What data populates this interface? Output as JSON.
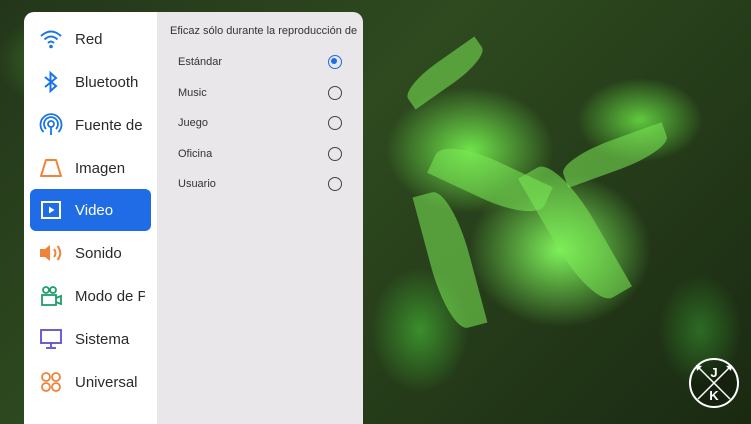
{
  "menu": {
    "items": [
      {
        "label": "Red",
        "icon": "wifi-icon",
        "active": false
      },
      {
        "label": "Bluetooth",
        "icon": "bluetooth-icon",
        "active": false
      },
      {
        "label": "Fuente de S",
        "icon": "source-icon",
        "active": false
      },
      {
        "label": "Imagen",
        "icon": "image-icon",
        "active": false
      },
      {
        "label": "Video",
        "icon": "video-icon",
        "active": true
      },
      {
        "label": "Sonido",
        "icon": "sound-icon",
        "active": false
      },
      {
        "label": "Modo de P",
        "icon": "projector-icon",
        "active": false
      },
      {
        "label": "Sistema",
        "icon": "monitor-icon",
        "active": false
      },
      {
        "label": "Universal",
        "icon": "universal-icon",
        "active": false
      }
    ]
  },
  "options": {
    "header": "Eficaz sólo durante la reproducción de",
    "items": [
      {
        "label": "Estándar",
        "selected": true
      },
      {
        "label": "Music",
        "selected": false
      },
      {
        "label": "Juego",
        "selected": false
      },
      {
        "label": "Oficina",
        "selected": false
      },
      {
        "label": "Usuario",
        "selected": false
      }
    ]
  },
  "logo": {
    "letters": [
      "J",
      "K"
    ]
  },
  "colors": {
    "accent": "#1f6ce6",
    "panel": "#ffffff",
    "options_bg": "#e9e7ea",
    "icon_blue": "#1a73e8",
    "icon_orange": "#f0823a",
    "icon_green": "#1f9e6a",
    "icon_purple": "#5b4fcf"
  }
}
